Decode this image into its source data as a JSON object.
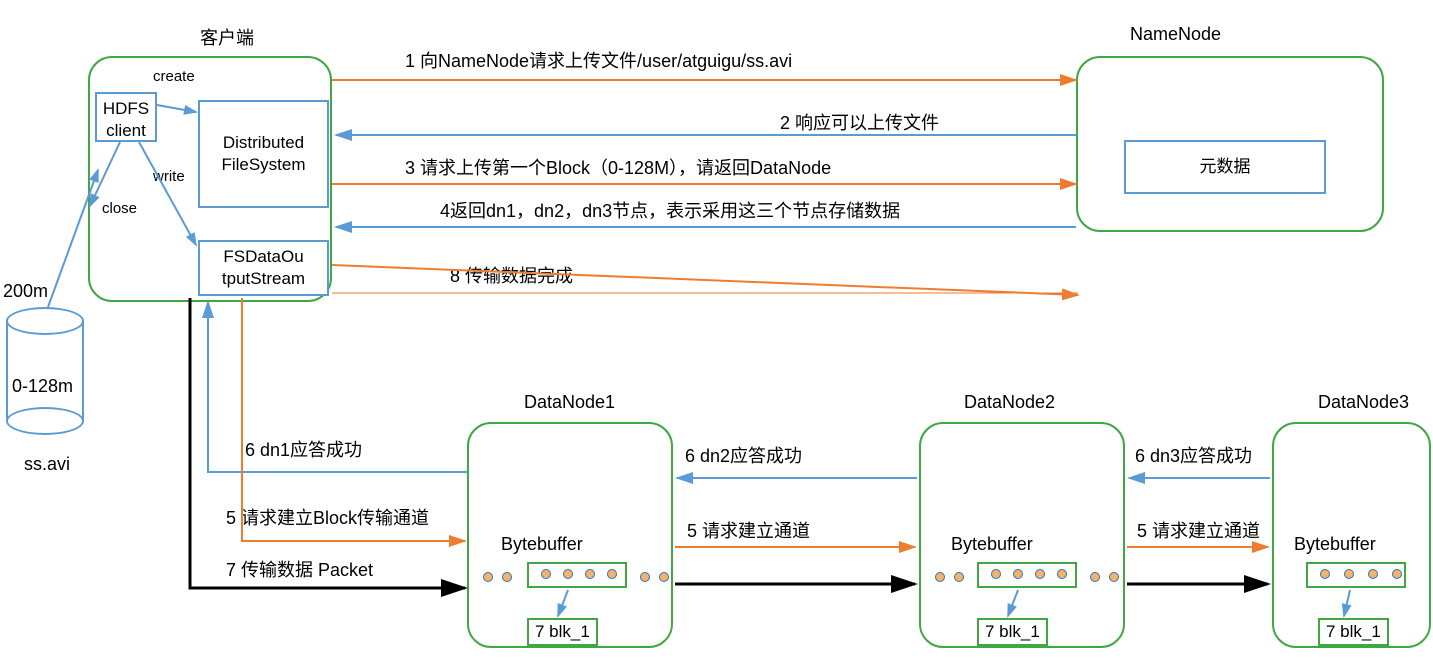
{
  "client": {
    "title": "客户端",
    "hdfs": "HDFS\nclient",
    "dfs": "Distributed\nFileSystem",
    "stream": "FSDataOu\ntputStream",
    "create": "create",
    "write": "write",
    "close": "close"
  },
  "namenode": {
    "title": "NameNode",
    "meta": "元数据"
  },
  "file": {
    "size": "200m",
    "block": "0-128m",
    "name": "ss.avi"
  },
  "messages": {
    "m1": "1 向NameNode请求上传文件/user/atguigu/ss.avi",
    "m2": "2 响应可以上传文件",
    "m3": "3 请求上传第一个Block（0-128M），请返回DataNode",
    "m4": "4返回dn1，dn2，dn3节点，表示采用这三个节点存储数据",
    "m8": "8 传输数据完成"
  },
  "dn": {
    "dn1": {
      "title": "DataNode1",
      "bytebuffer": "Bytebuffer",
      "blk": "7 blk_1",
      "ack": "6 dn1应答成功",
      "req": "5 请求建立Block传输通道"
    },
    "dn2": {
      "title": "DataNode2",
      "bytebuffer": "Bytebuffer",
      "blk": "7 blk_1",
      "ack": "6 dn2应答成功",
      "req": "5 请求建立通道"
    },
    "dn3": {
      "title": "DataNode3",
      "bytebuffer": "Bytebuffer",
      "blk": "7 blk_1",
      "ack": "6 dn3应答成功",
      "req": "5 请求建立通道"
    }
  },
  "packet": "7 传输数据 Packet",
  "watermark": ""
}
